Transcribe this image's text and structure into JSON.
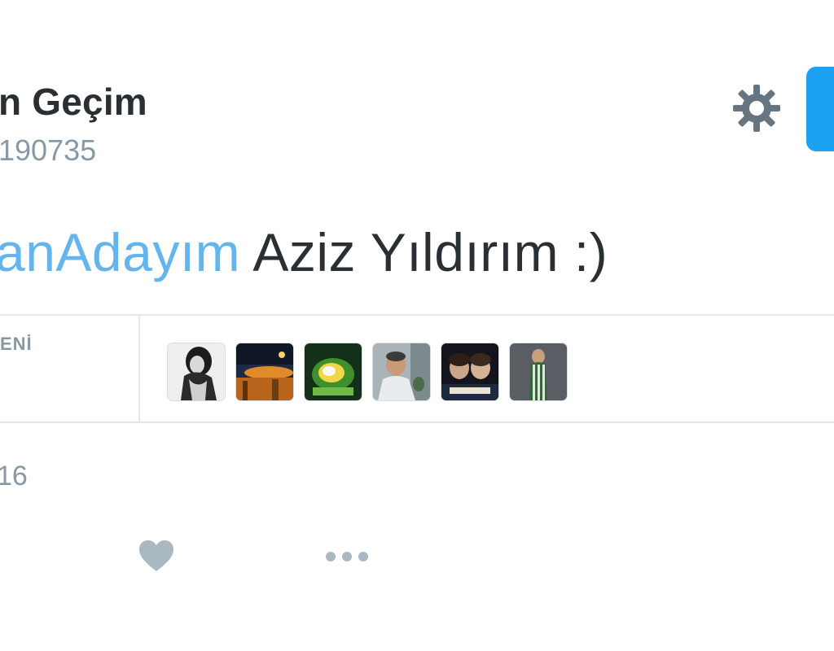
{
  "header": {
    "display_name": "n Geçim",
    "handle": "190735"
  },
  "actions": {
    "settings_icon": "gear-icon",
    "follow_button_color": "#1da1f2"
  },
  "tweet": {
    "hashtag": "anAdayım",
    "text": " Aziz Yıldırım :)",
    "hashtag_color": "#64b5ee"
  },
  "stats": {
    "label": "ENİ",
    "avatar_count": 6
  },
  "meta": {
    "timestamp": "16"
  },
  "footer": {
    "icons": [
      "heart-icon",
      "more-icon"
    ]
  }
}
